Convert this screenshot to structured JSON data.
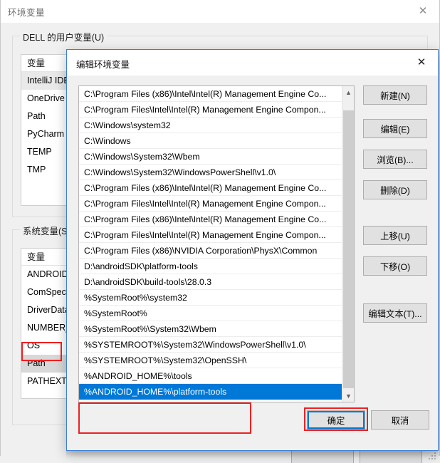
{
  "parent_window": {
    "title": "环境变量",
    "close_icon": "close-icon",
    "user_group": {
      "label": "DELL 的用户变量(U)",
      "column_header": "变量",
      "rows": [
        "IntelliJ IDE",
        "OneDrive",
        "Path",
        "PyCharm C",
        "TEMP",
        "TMP"
      ]
    },
    "system_group": {
      "label": "系统变量(S)",
      "column_header": "变量",
      "rows": [
        "ANDROID_",
        "ComSpec",
        "DriverData",
        "NUMBER_",
        "OS",
        "Path",
        "PATHEXT"
      ],
      "highlighted_row": "Path"
    }
  },
  "dialog": {
    "title": "编辑环境变量",
    "close_icon": "close-icon",
    "path_entries": [
      {
        "text": "C:\\Program Files (x86)\\Intel\\Intel(R) Management Engine Co...",
        "selected": false
      },
      {
        "text": "C:\\Program Files\\Intel\\Intel(R) Management Engine Compon...",
        "selected": false
      },
      {
        "text": "C:\\Windows\\system32",
        "selected": false
      },
      {
        "text": "C:\\Windows",
        "selected": false
      },
      {
        "text": "C:\\Windows\\System32\\Wbem",
        "selected": false
      },
      {
        "text": "C:\\Windows\\System32\\WindowsPowerShell\\v1.0\\",
        "selected": false
      },
      {
        "text": "C:\\Program Files (x86)\\Intel\\Intel(R) Management Engine Co...",
        "selected": false
      },
      {
        "text": "C:\\Program Files\\Intel\\Intel(R) Management Engine Compon...",
        "selected": false
      },
      {
        "text": "C:\\Program Files (x86)\\Intel\\Intel(R) Management Engine Co...",
        "selected": false
      },
      {
        "text": "C:\\Program Files\\Intel\\Intel(R) Management Engine Compon...",
        "selected": false
      },
      {
        "text": "C:\\Program Files (x86)\\NVIDIA Corporation\\PhysX\\Common",
        "selected": false
      },
      {
        "text": "D:\\androidSDK\\platform-tools",
        "selected": false
      },
      {
        "text": "D:\\androidSDK\\build-tools\\28.0.3",
        "selected": false
      },
      {
        "text": "%SystemRoot%\\system32",
        "selected": false
      },
      {
        "text": "%SystemRoot%",
        "selected": false
      },
      {
        "text": "%SystemRoot%\\System32\\Wbem",
        "selected": false
      },
      {
        "text": "%SYSTEMROOT%\\System32\\WindowsPowerShell\\v1.0\\",
        "selected": false
      },
      {
        "text": "%SYSTEMROOT%\\System32\\OpenSSH\\",
        "selected": false
      },
      {
        "text": "%ANDROID_HOME%\\tools",
        "selected": false
      },
      {
        "text": "%ANDROID_HOME%\\platform-tools",
        "selected": true
      }
    ],
    "scrollbar": {
      "up_icon": "chevron-up-icon",
      "down_icon": "chevron-down-icon"
    },
    "buttons": {
      "new": "新建(N)",
      "edit": "编辑(E)",
      "browse": "浏览(B)...",
      "delete": "删除(D)",
      "move_up": "上移(U)",
      "move_down": "下移(O)",
      "edit_text": "编辑文本(T)...",
      "ok": "确定",
      "cancel": "取消"
    }
  },
  "annotations": {
    "accent_color": "#f02020",
    "selection_color": "#0078d7"
  }
}
